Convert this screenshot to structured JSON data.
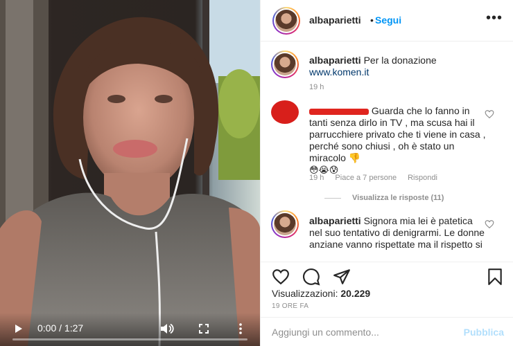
{
  "header": {
    "username": "albaparietti",
    "separator": "•",
    "follow_label": "Segui",
    "more_icon": "more-horizontal-icon"
  },
  "video": {
    "time": "0:00 / 1:27",
    "progress": 0.0,
    "icons": [
      "play-icon",
      "volume-icon",
      "fullscreen-icon",
      "more-vertical-icon"
    ]
  },
  "comments": [
    {
      "username": "albaparietti",
      "text": "Per la donazione",
      "link": "www.komen.it",
      "time": "19 h"
    },
    {
      "username": "",
      "text": "Guarda che lo fanno in tanti senza dirlo in TV , ma scusa hai il parrucchiere privato che ti viene in casa , perché sono chiusi , oh è stato un miracolo 👎",
      "emojis": "😳😭😰",
      "time": "19 h",
      "likes": "Piace a 7 persone",
      "reply_label": "Rispondi",
      "view_replies": "Visualizza le risposte (11)"
    },
    {
      "username": "albaparietti",
      "text": "Signora mia lei è patetica nel suo tentativo di denigrarmi. Le donne anziane vanno rispettate ma il rispetto si"
    }
  ],
  "actions": {
    "views_label": "Visualizzazioni:",
    "views_count": "20.229",
    "post_time": "19 ORE FA"
  },
  "comment_box": {
    "placeholder": "Aggiungi un commento...",
    "publish_label": "Pubblica"
  },
  "colors": {
    "accent": "#0095f6",
    "publish_disabled": "#b2dffc",
    "meta": "#8e8e8e",
    "redaction": "#e0251f"
  }
}
